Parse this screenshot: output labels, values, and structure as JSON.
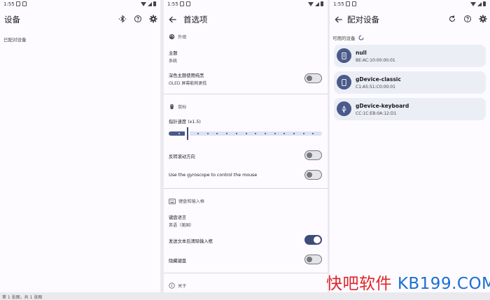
{
  "status_bar": {
    "time": "1:55"
  },
  "panel_devices": {
    "title": "设备",
    "paired_label": "已配对设备"
  },
  "panel_prefs": {
    "title": "首选项",
    "appearance": {
      "section": "外观",
      "theme_title": "主题",
      "theme_value": "系统",
      "dark_title": "深色主题使用纯黑",
      "dark_sub": "OLED 屏幕能耗更低",
      "dark_on": false
    },
    "mouse": {
      "section": "鼠标",
      "speed_title": "指针速度 (x1.5)",
      "speed_fraction": 0.12,
      "reverse_title": "反转滚动方向",
      "reverse_on": false,
      "gyro_title": "Use the gyroscope to control the mouse",
      "gyro_on": false
    },
    "keyboard": {
      "section": "键盘和输入框",
      "lang_title": "键盘语言",
      "lang_value": "英语（美国）",
      "clear_title": "发送文本后清除输入框",
      "clear_on": true,
      "hide_title": "隐藏键盘",
      "hide_on": false
    },
    "about": {
      "section": "关于"
    }
  },
  "panel_pair": {
    "title": "配对设备",
    "available_label": "可用的设备",
    "devices": [
      {
        "name": "null",
        "address": "BE:AC:10:00:00:01",
        "icon": "phone-icon"
      },
      {
        "name": "gDevice-classic",
        "address": "C1:A5:51:C0:00:01",
        "icon": "phone-icon"
      },
      {
        "name": "gDevice-keyboard",
        "address": "CC:1C:EB:0A:12:D1",
        "icon": "usb-icon"
      }
    ]
  },
  "footer": {
    "caption": "第 1 张图，共 1 张图"
  },
  "watermark": {
    "part1": "快吧软件 ",
    "part2": "KB199.COM"
  },
  "colors": {
    "accent": "#3c4d7a",
    "watermark_red": "#e0242b",
    "watermark_blue": "#1c6fd1"
  }
}
